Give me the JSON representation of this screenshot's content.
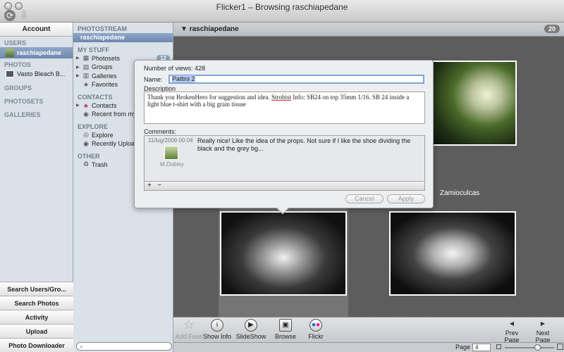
{
  "window": {
    "title": "Flicker1 – Browsing raschiapedane"
  },
  "sidebar": {
    "account_label": "Account",
    "users_heading": "USERS",
    "user_name": "raschiapedane",
    "photos_heading": "PHOTOS",
    "photo_item": "Vasto Bleach B...",
    "groups_heading": "GROUPS",
    "photosets_heading": "PHOTOSETS",
    "galleries_heading": "GALLERIES",
    "bottom_buttons": [
      "Search Users/Gro...",
      "Search Photos",
      "Activity",
      "Upload",
      "Photo Downloader"
    ]
  },
  "sidebar2": {
    "photostream_heading": "PHOTOSTREAM",
    "photostream_user": "raschiapedane",
    "mystuff_heading": "MY STUFF",
    "photosets_label": "Photosets",
    "photosets_count": "12",
    "groups_label": "Groups",
    "galleries_label": "Galleries",
    "favorites_label": "Favorites",
    "contacts_heading": "CONTACTS",
    "contacts_label": "Contacts",
    "recent_label": "Recent from my co",
    "explore_heading": "EXPLORE",
    "explore_label": "Explore",
    "recently_uploaded_label": "Recently Uploaded",
    "other_heading": "OTHER",
    "trash_label": "Trash"
  },
  "main": {
    "header_title": "raschiapedane",
    "photo_count": "20",
    "caption": "Zamioculcas"
  },
  "dialog": {
    "views_label": "Number of views:",
    "views_value": "428",
    "name_label": "Name:",
    "name_value": "Pattini 2",
    "description_label": "Description",
    "description_pre": "Thank you BrokenHero for suggestion and idea. ",
    "description_underlined": "Strobist",
    "description_post": " Info: SB24 on top 35mm 1/16. SB 24 inside a light blue t-shirt with a big grain tissue",
    "comments_label": "Comments:",
    "comment_date": "11/lug/2009 00:04",
    "comment_text": "Really nice! Like the idea of the props. Not sure if I like the shoe dividing the black and the grey bg...",
    "comment_user": "M.Dobley",
    "add_symbol": "+",
    "remove_symbol": "−",
    "cancel_label": "Cancel",
    "apply_label": "Apply"
  },
  "toolbar": {
    "add_fave": "Add Fave",
    "show_info": "Show Info",
    "slideshow": "SlideShow",
    "browse": "Browse",
    "flickr": "Flickr",
    "prev_page": "Prev Page",
    "next_page": "Next Page"
  },
  "status": {
    "page_label": "Page",
    "page_value": "4"
  }
}
